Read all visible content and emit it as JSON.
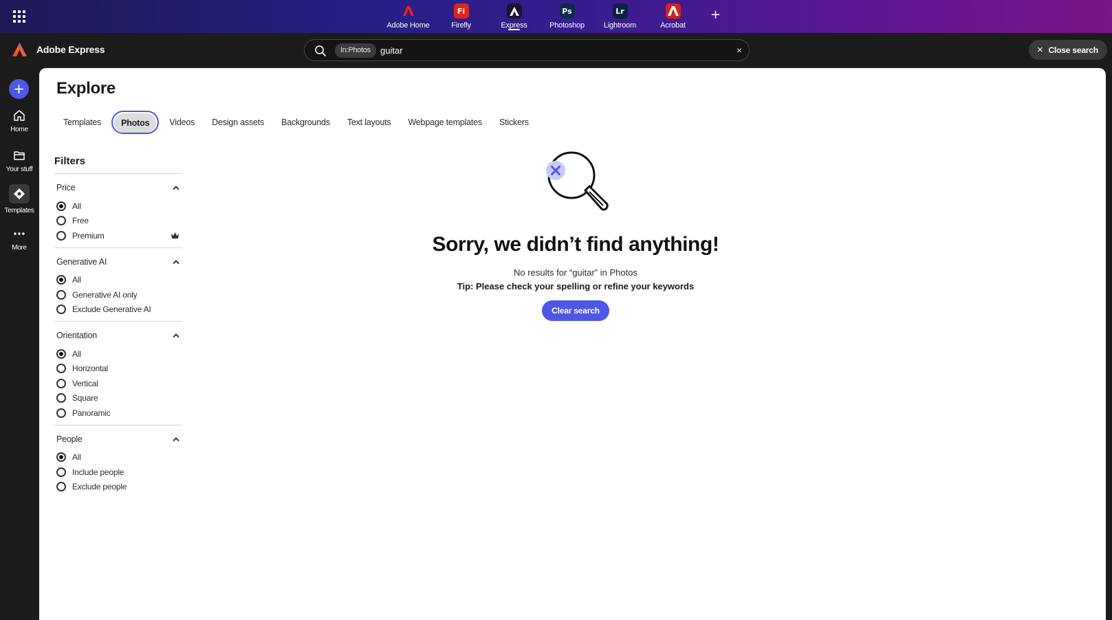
{
  "appbar": {
    "apps": [
      {
        "label": "Adobe Home",
        "icon": "adobe-logo-icon",
        "color": "#1f1f1f",
        "glyph": ""
      },
      {
        "label": "Firefly",
        "icon": "firefly-app-icon",
        "color": "#e1251b",
        "glyph": "Fi"
      },
      {
        "label": "Express",
        "icon": "express-app-icon",
        "color": "#1a1433",
        "glyph": ""
      },
      {
        "label": "Photoshop",
        "icon": "photoshop-app-icon",
        "color": "#0e2a4d",
        "glyph": "Ps"
      },
      {
        "label": "Lightroom",
        "icon": "lightroom-app-icon",
        "color": "#0d2240",
        "glyph": "Lr"
      },
      {
        "label": "Acrobat",
        "icon": "acrobat-app-icon",
        "color": "#d4221a",
        "glyph": ""
      }
    ],
    "active_app": "Express",
    "add_label": "+"
  },
  "header": {
    "brand": "Adobe Express",
    "search_scope": "In:Photos",
    "search_value": "guitar",
    "clear_glyph": "×",
    "close_search": "Close search",
    "close_glyph": "×"
  },
  "rail": {
    "plus": "+",
    "items": [
      {
        "label": "Home",
        "icon": "home-icon"
      },
      {
        "label": "Your stuff",
        "icon": "folder-icon"
      },
      {
        "label": "Templates",
        "icon": "templates-icon"
      },
      {
        "label": "More",
        "icon": "more-dots-icon"
      }
    ]
  },
  "main": {
    "title": "Explore",
    "tabs": [
      "Templates",
      "Photos",
      "Videos",
      "Design assets",
      "Backgrounds",
      "Text layouts",
      "Webpage templates",
      "Stickers"
    ],
    "active_tab": "Photos"
  },
  "filters": {
    "title": "Filters",
    "groups": [
      {
        "label": "Price",
        "options": [
          "All",
          "Free",
          "Premium"
        ],
        "selected": "All"
      },
      {
        "label": "Generative AI",
        "options": [
          "All",
          "Generative AI only",
          "Exclude Generative AI"
        ],
        "selected": "All"
      },
      {
        "label": "Orientation",
        "options": [
          "All",
          "Horizontal",
          "Vertical",
          "Square",
          "Panoramic"
        ],
        "selected": "All"
      },
      {
        "label": "People",
        "options": [
          "All",
          "Include people",
          "Exclude people"
        ],
        "selected": "All"
      }
    ]
  },
  "empty_state": {
    "title": "Sorry, we didn’t find anything!",
    "description": "No results for “guitar” in Photos",
    "tip": "Tip: Please check your spelling or refine your keywords",
    "button": "Clear search"
  },
  "colors": {
    "accent": "#4f57e6",
    "tab_outline": "#4a54e1"
  }
}
